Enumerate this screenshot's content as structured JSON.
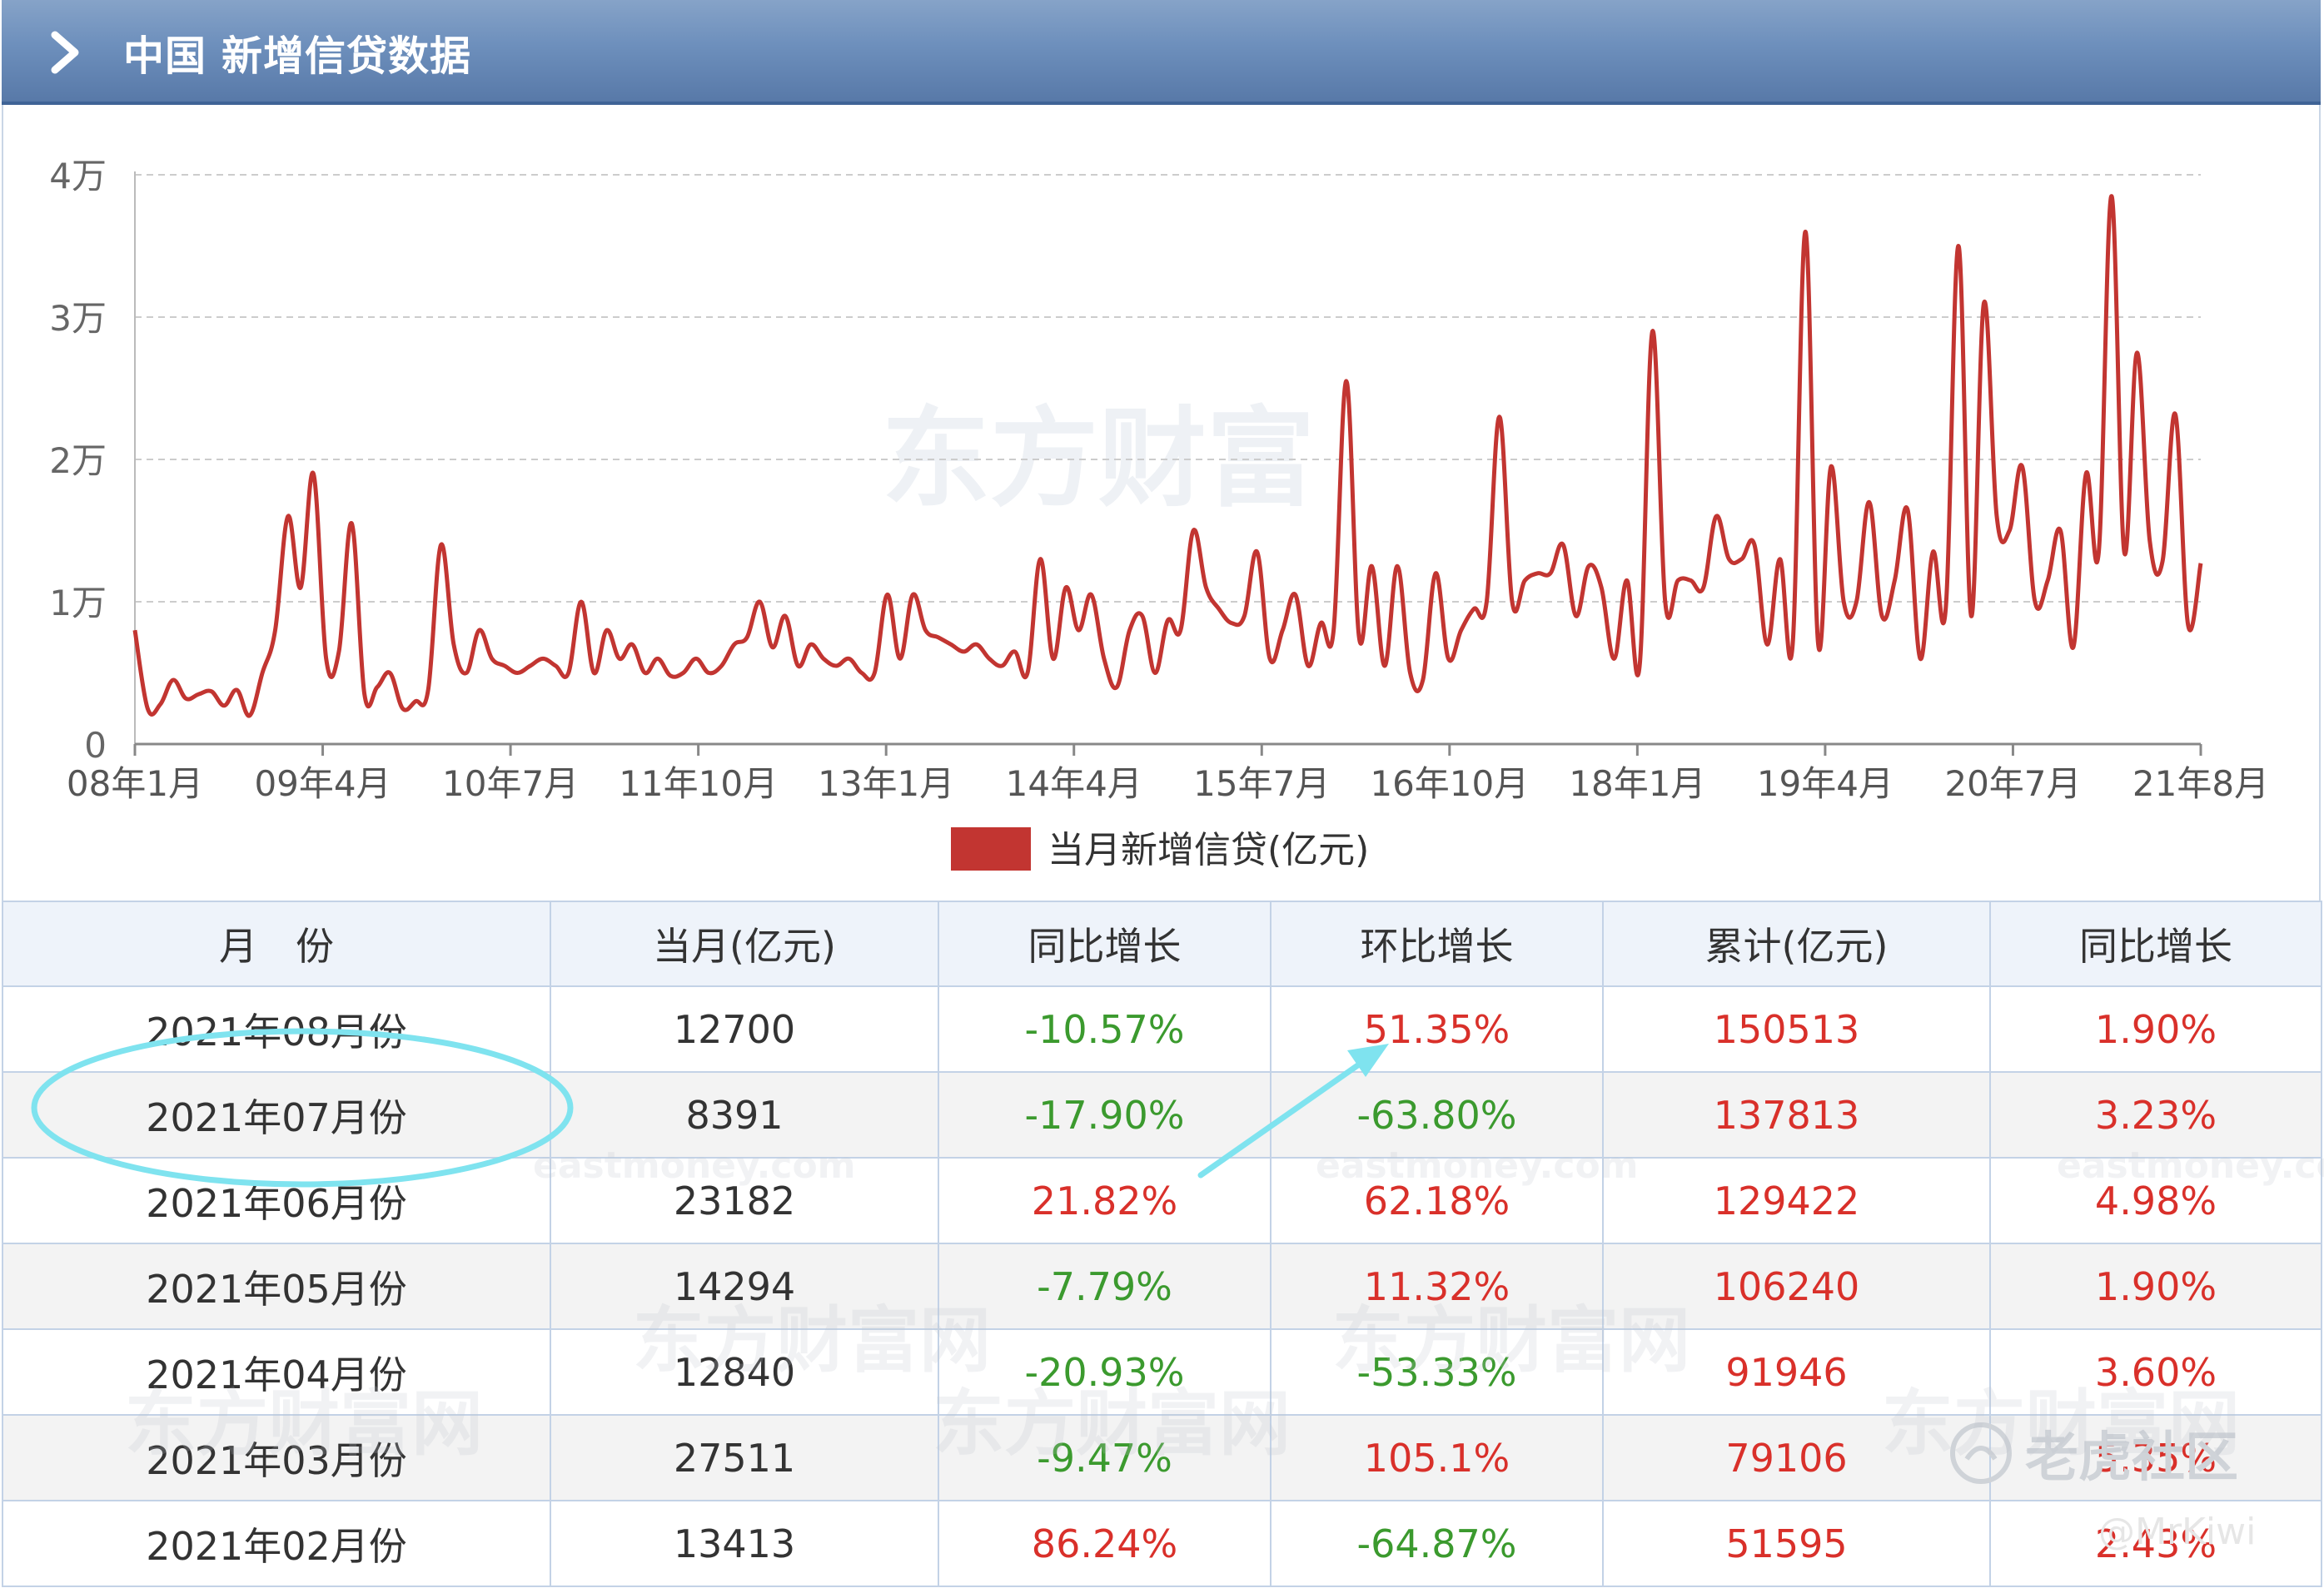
{
  "header": {
    "title": "中国 新增信贷数据",
    "icon": "chevron-right-icon"
  },
  "colors": {
    "header": "#6d8fbc",
    "series": "#c23531",
    "up": "#d9302a",
    "down": "#3b9a2e",
    "annotation": "#7fe3ef"
  },
  "watermark": {
    "text": "东方财富",
    "table_text": "东方财富网",
    "sub_text": "eastmoney.com"
  },
  "chart_data": {
    "type": "line",
    "title": "",
    "ylim": [
      0,
      40000
    ],
    "yticks": [
      "0",
      "1万",
      "2万",
      "3万",
      "4万"
    ],
    "xlabels": [
      "08年1月",
      "09年4月",
      "10年7月",
      "11年10月",
      "13年1月",
      "14年4月",
      "15年7月",
      "16年10月",
      "18年1月",
      "19年4月",
      "20年7月",
      "21年8月"
    ],
    "grid": true,
    "legend_position": "bottom-center",
    "series": [
      {
        "name": "当月新增信贷(亿元)",
        "x_start": "2008-01",
        "x_end": "2021-08",
        "values": [
          8000,
          2500,
          2800,
          4500,
          3200,
          3500,
          3700,
          2700,
          3800,
          2000,
          5000,
          8000,
          16000,
          11000,
          19000,
          6000,
          6500,
          15500,
          3500,
          4000,
          5000,
          2500,
          3000,
          3800,
          14000,
          7000,
          5000,
          8000,
          6000,
          5500,
          5000,
          5500,
          6000,
          5500,
          5000,
          10000,
          5000,
          8000,
          6000,
          7000,
          5000,
          6000,
          4800,
          5000,
          6000,
          5000,
          5500,
          7000,
          7500,
          10000,
          6800,
          9000,
          5500,
          7000,
          6000,
          5500,
          6000,
          5000,
          5000,
          10500,
          6000,
          10500,
          8000,
          7500,
          7000,
          6500,
          7000,
          6000,
          5500,
          6500,
          5000,
          13000,
          6000,
          11000,
          8000,
          10500,
          6000,
          4000,
          8000,
          9000,
          5000,
          8700,
          8000,
          15000,
          11000,
          9500,
          8500,
          9000,
          13500,
          6000,
          8000,
          10500,
          5500,
          8500,
          8000,
          25500,
          7500,
          12500,
          5500,
          12500,
          5000,
          4500,
          12000,
          6000,
          8000,
          9500,
          10000,
          23000,
          10000,
          11500,
          12000,
          12000,
          14000,
          9000,
          12500,
          11000,
          6000,
          11500,
          5500,
          29000,
          10000,
          11500,
          11500,
          11000,
          16000,
          13000,
          13000,
          14000,
          7000,
          13000,
          7000,
          36000,
          7000,
          19500,
          10000,
          10000,
          17000,
          9000,
          11500,
          16500,
          6000,
          13500,
          9500,
          35000,
          9000,
          31000,
          16000,
          15000,
          19500,
          10000,
          11500,
          15000,
          6800,
          19000,
          13500,
          38500,
          13500,
          27500,
          14300,
          12840,
          23182,
          8391,
          12700
        ]
      }
    ]
  },
  "table": {
    "columns": [
      "月　份",
      "当月(亿元)",
      "同比增长",
      "环比增长",
      "累计(亿元)",
      "同比增长"
    ],
    "rows": [
      [
        "2021年08月份",
        "12700",
        "-10.57%",
        "51.35%",
        "150513",
        "1.90%"
      ],
      [
        "2021年07月份",
        "8391",
        "-17.90%",
        "-63.80%",
        "137813",
        "3.23%"
      ],
      [
        "2021年06月份",
        "23182",
        "21.82%",
        "62.18%",
        "129422",
        "4.98%"
      ],
      [
        "2021年05月份",
        "14294",
        "-7.79%",
        "11.32%",
        "106240",
        "1.90%"
      ],
      [
        "2021年04月份",
        "12840",
        "-20.93%",
        "-53.33%",
        "91946",
        "3.60%"
      ],
      [
        "2021年03月份",
        "27511",
        "-9.47%",
        "105.1%",
        "79106",
        "5.35%"
      ],
      [
        "2021年02月份",
        "13413",
        "86.24%",
        "-64.87%",
        "51595",
        "2.43%"
      ]
    ]
  },
  "overlay": {
    "community": "老虎社区",
    "handle": "@MrKiwi"
  }
}
